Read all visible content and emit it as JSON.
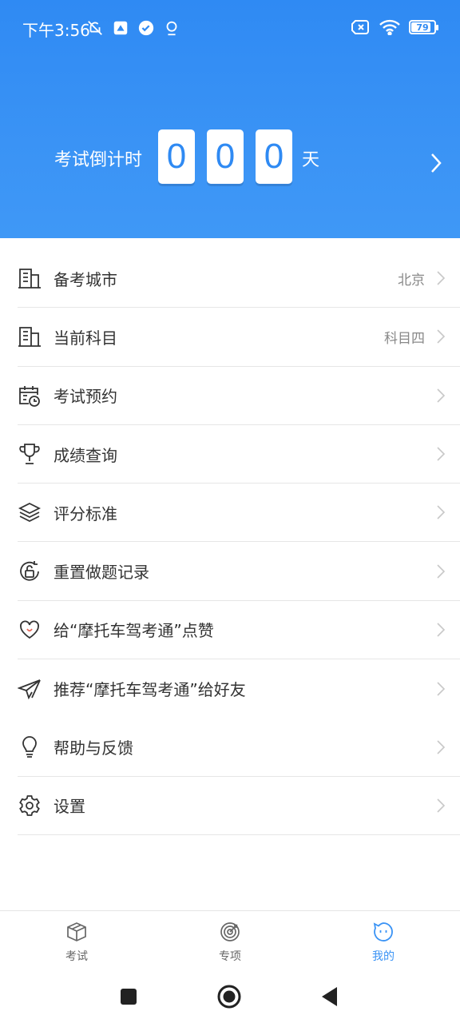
{
  "status": {
    "time": "下午3:56",
    "battery": "79"
  },
  "countdown": {
    "label": "考试倒计时",
    "digits": [
      "0",
      "0",
      "0"
    ],
    "unit": "天"
  },
  "menu": [
    {
      "label": "备考城市",
      "value": "北京",
      "icon": "building-icon"
    },
    {
      "label": "当前科目",
      "value": "科目四",
      "icon": "building-icon"
    },
    {
      "label": "考试预约",
      "value": "",
      "icon": "calendar-clock-icon"
    },
    {
      "label": "成绩查询",
      "value": "",
      "icon": "trophy-icon"
    },
    {
      "label": "评分标准",
      "value": "",
      "icon": "layers-icon"
    },
    {
      "label": "重置做题记录",
      "value": "",
      "icon": "reset-lock-icon"
    },
    {
      "label": "给“摩托车驾考通”点赞",
      "value": "",
      "icon": "heart-icon"
    },
    {
      "label": "推荐“摩托车驾考通”给好友",
      "value": "",
      "icon": "paper-plane-icon"
    },
    {
      "label": "帮助与反馈",
      "value": "",
      "icon": "lightbulb-icon"
    },
    {
      "label": "设置",
      "value": "",
      "icon": "gear-icon"
    }
  ],
  "tabs": [
    {
      "label": "考试",
      "icon": "box-icon",
      "active": false
    },
    {
      "label": "专项",
      "icon": "target-icon",
      "active": false
    },
    {
      "label": "我的",
      "icon": "smiley-icon",
      "active": true
    }
  ],
  "colors": {
    "accent": "#3a93f5",
    "header": "#2f8af3"
  }
}
